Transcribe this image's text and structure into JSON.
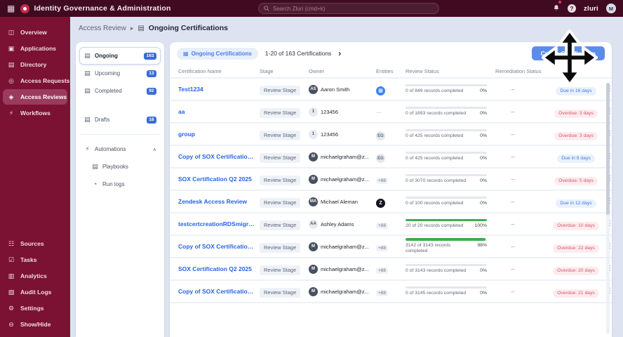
{
  "colors": {
    "topbar_maroon": "#400a20",
    "sidebar_maroon": "#7b1133",
    "accent_blue": "#5b8cea",
    "link_blue": "#2563eb",
    "badge_blue": "#3a6bd8",
    "due_blue": "#3f78e0",
    "overdue_red": "#d4526a",
    "progress_green": "#3fae4e"
  },
  "topbar": {
    "grid_glyph": "▦",
    "app_title": "Identity Governance & Administration",
    "search_placeholder": "Search Zluri (cmd+k)",
    "help_glyph": "?",
    "brand": "zluri",
    "avatar_initial": "M"
  },
  "sidebar": {
    "top_items": [
      {
        "icon": "overview-icon",
        "glyph": "◫",
        "label": "Overview",
        "state": ""
      },
      {
        "icon": "applications-icon",
        "glyph": "▣",
        "label": "Applications",
        "state": ""
      },
      {
        "icon": "directory-icon",
        "glyph": "▤",
        "label": "Directory",
        "state": ""
      },
      {
        "icon": "access-requests-icon",
        "glyph": "◎",
        "label": "Access Requests",
        "state": ""
      },
      {
        "icon": "access-reviews-icon",
        "glyph": "◈",
        "label": "Access Reviews",
        "state": "active"
      },
      {
        "icon": "workflows-icon",
        "glyph": "⚡",
        "label": "Workflows",
        "state": ""
      }
    ],
    "bottom_items": [
      {
        "icon": "sources-icon",
        "glyph": "☷",
        "label": "Sources"
      },
      {
        "icon": "tasks-icon",
        "glyph": "☑",
        "label": "Tasks"
      },
      {
        "icon": "analytics-icon",
        "glyph": "▥",
        "label": "Analytics"
      },
      {
        "icon": "audit-logs-icon",
        "glyph": "▧",
        "label": "Audit Logs"
      },
      {
        "icon": "settings-icon",
        "glyph": "⚙",
        "label": "Settings"
      },
      {
        "icon": "show-hide-icon",
        "glyph": "⊖",
        "label": "Show/Hide"
      }
    ]
  },
  "breadcrumb": {
    "parent": "Access Review",
    "separator": "▸",
    "doc_glyph": "▤",
    "current": "Ongoing Certifications"
  },
  "subnav": {
    "items": [
      {
        "icon": "ongoing-icon",
        "glyph": "▤",
        "label": "Ongoing",
        "badge": "163",
        "state": "active"
      },
      {
        "icon": "upcoming-icon",
        "glyph": "▤",
        "label": "Upcoming",
        "badge": "13",
        "state": ""
      },
      {
        "icon": "completed-icon",
        "glyph": "▤",
        "label": "Completed",
        "badge": "92",
        "state": ""
      },
      {
        "icon": "drafts-icon",
        "glyph": "▤",
        "label": "Drafts",
        "badge": "18",
        "state": ""
      }
    ],
    "automations": {
      "icon": "automations-icon",
      "glyph": "⚡",
      "label": "Automations",
      "collapse_glyph": "∧"
    },
    "children": [
      {
        "icon": "playbooks-icon",
        "glyph": "▤",
        "label": "Playbooks"
      },
      {
        "icon": "run-logs-icon",
        "glyph": "◔",
        "label": "Run logs"
      }
    ]
  },
  "header": {
    "tab_glyph": "▦",
    "tab_label": "Ongoing Certifications",
    "count": "1-20 of 163 Certifications",
    "next_glyph": "›",
    "create_label": "Create Certification"
  },
  "table": {
    "columns": [
      "Certification Name",
      "Stage",
      "Owner",
      "Entities",
      "Review Status",
      "Remediation Status"
    ],
    "rows": [
      {
        "name": "Test1234",
        "stage": "Review Stage",
        "owner": {
          "initials": "AS",
          "name": "Aaron Smith",
          "variant": "avatar-dark"
        },
        "entity": {
          "type": "entity-apps",
          "label": "▦"
        },
        "review": {
          "label": "0 of 849 records completed",
          "pct": 0,
          "pct_label": "0%",
          "state": "bar-empty"
        },
        "remediation": "–",
        "due": {
          "label": "Due in 16 days",
          "type": "due-blue"
        }
      },
      {
        "name": "aa",
        "stage": "Review Stage",
        "owner": {
          "initials": "1",
          "name": "123456",
          "variant": "avatar-light"
        },
        "entity": {
          "type": "entity-dash",
          "label": "⋯"
        },
        "review": {
          "label": "0 of 1893 records completed",
          "pct": 0,
          "pct_label": "0%",
          "state": "bar-empty"
        },
        "remediation": "–",
        "due": {
          "label": "Overdue: 3 days",
          "type": "due-red"
        }
      },
      {
        "name": "group",
        "stage": "Review Stage",
        "owner": {
          "initials": "1",
          "name": "123456",
          "variant": "avatar-light"
        },
        "entity": {
          "type": "entity-initials",
          "label": "EG"
        },
        "review": {
          "label": "0 of 425 records completed",
          "pct": 0,
          "pct_label": "0%",
          "state": "bar-empty"
        },
        "remediation": "–",
        "due": {
          "label": "Overdue: 3 days",
          "type": "due-red"
        }
      },
      {
        "name": "Copy of SOX Certification Q2 2...",
        "stage": "Review Stage",
        "owner": {
          "initials": "M",
          "name": "michaelgraham@z...",
          "variant": "avatar-dark"
        },
        "entity": {
          "type": "entity-initials",
          "label": "EG"
        },
        "review": {
          "label": "0 of 425 records completed",
          "pct": 0,
          "pct_label": "0%",
          "state": "bar-empty"
        },
        "remediation": "–",
        "due": {
          "label": "Due in 8 days",
          "type": "due-blue"
        }
      },
      {
        "name": "SOX Certification Q2 2025",
        "stage": "Review Stage",
        "owner": {
          "initials": "M",
          "name": "michaelgraham@z...",
          "variant": "avatar-dark"
        },
        "entity": {
          "type": "entity-overflow",
          "label": "+88"
        },
        "review": {
          "label": "0 of 3070 records completed",
          "pct": 0,
          "pct_label": "0%",
          "state": "bar-empty"
        },
        "remediation": "–",
        "due": {
          "label": "Overdue: 5 days",
          "type": "due-red"
        }
      },
      {
        "name": "Zendesk Access Review",
        "stage": "Review Stage",
        "owner": {
          "initials": "MA",
          "name": "Michael Aleman",
          "variant": "avatar-dark"
        },
        "entity": {
          "type": "entity-zendesk",
          "label": "Z"
        },
        "review": {
          "label": "0 of 100 records completed",
          "pct": 0,
          "pct_label": "0%",
          "state": "bar-empty"
        },
        "remediation": "–",
        "due": {
          "label": "Due in 12 days",
          "type": "due-blue"
        }
      },
      {
        "name": "testcertcreationRDSmigration",
        "stage": "Review Stage",
        "owner": {
          "initials": "AA",
          "name": "Ashley Adams",
          "variant": "avatar-light"
        },
        "entity": {
          "type": "entity-overflow",
          "label": "+88"
        },
        "review": {
          "label": "20 of 20 records completed",
          "pct": 100,
          "pct_label": "100%",
          "state": "bar-done"
        },
        "remediation": "–",
        "due": {
          "label": "Overdue: 10 days",
          "type": "due-red"
        }
      },
      {
        "name": "Copy of SOX Certification Q2 2...",
        "stage": "Review Stage",
        "owner": {
          "initials": "M",
          "name": "michaelgraham@z...",
          "variant": "avatar-dark"
        },
        "entity": {
          "type": "entity-overflow",
          "label": "+88"
        },
        "review": {
          "label": "3142 of 3143 records completed",
          "pct": 98,
          "pct_label": "98%",
          "state": "bar-done"
        },
        "remediation": "–",
        "due": {
          "label": "Overdue: 22 days",
          "type": "due-red"
        }
      },
      {
        "name": "SOX Certification Q2 2025",
        "stage": "Review Stage",
        "owner": {
          "initials": "M",
          "name": "michaelgraham@z...",
          "variant": "avatar-dark"
        },
        "entity": {
          "type": "entity-overflow",
          "label": "+88"
        },
        "review": {
          "label": "0 of 3143 records completed",
          "pct": 0,
          "pct_label": "0%",
          "state": "bar-empty"
        },
        "remediation": "–",
        "due": {
          "label": "Overdue: 20 days",
          "type": "due-red"
        }
      },
      {
        "name": "Copy of SOX Certification Q2 2...",
        "stage": "Review Stage",
        "owner": {
          "initials": "M",
          "name": "michaelgraham@z...",
          "variant": "avatar-dark"
        },
        "entity": {
          "type": "entity-overflow",
          "label": "+88"
        },
        "review": {
          "label": "0 of 3145 records completed",
          "pct": 0,
          "pct_label": "0%",
          "state": "bar-empty"
        },
        "remediation": "–",
        "due": {
          "label": "Overdue: 21 days",
          "type": "due-red"
        }
      }
    ]
  },
  "misc": {
    "kebab_glyph": "⋮"
  }
}
